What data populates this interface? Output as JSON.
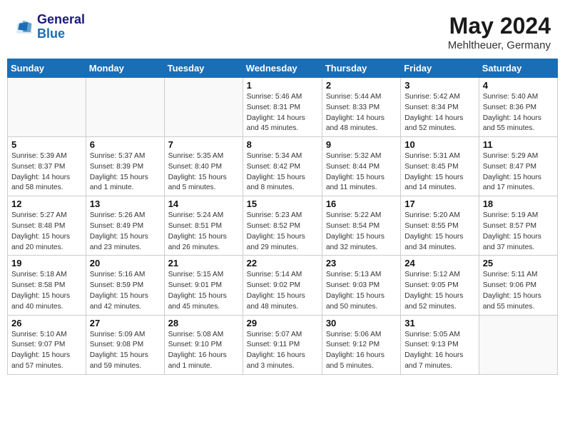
{
  "header": {
    "logo_line1": "General",
    "logo_line2": "Blue",
    "month_year": "May 2024",
    "location": "Mehltheuer, Germany"
  },
  "weekdays": [
    "Sunday",
    "Monday",
    "Tuesday",
    "Wednesday",
    "Thursday",
    "Friday",
    "Saturday"
  ],
  "weeks": [
    [
      {
        "day": "",
        "info": ""
      },
      {
        "day": "",
        "info": ""
      },
      {
        "day": "",
        "info": ""
      },
      {
        "day": "1",
        "info": "Sunrise: 5:46 AM\nSunset: 8:31 PM\nDaylight: 14 hours\nand 45 minutes."
      },
      {
        "day": "2",
        "info": "Sunrise: 5:44 AM\nSunset: 8:33 PM\nDaylight: 14 hours\nand 48 minutes."
      },
      {
        "day": "3",
        "info": "Sunrise: 5:42 AM\nSunset: 8:34 PM\nDaylight: 14 hours\nand 52 minutes."
      },
      {
        "day": "4",
        "info": "Sunrise: 5:40 AM\nSunset: 8:36 PM\nDaylight: 14 hours\nand 55 minutes."
      }
    ],
    [
      {
        "day": "5",
        "info": "Sunrise: 5:39 AM\nSunset: 8:37 PM\nDaylight: 14 hours\nand 58 minutes."
      },
      {
        "day": "6",
        "info": "Sunrise: 5:37 AM\nSunset: 8:39 PM\nDaylight: 15 hours\nand 1 minute."
      },
      {
        "day": "7",
        "info": "Sunrise: 5:35 AM\nSunset: 8:40 PM\nDaylight: 15 hours\nand 5 minutes."
      },
      {
        "day": "8",
        "info": "Sunrise: 5:34 AM\nSunset: 8:42 PM\nDaylight: 15 hours\nand 8 minutes."
      },
      {
        "day": "9",
        "info": "Sunrise: 5:32 AM\nSunset: 8:44 PM\nDaylight: 15 hours\nand 11 minutes."
      },
      {
        "day": "10",
        "info": "Sunrise: 5:31 AM\nSunset: 8:45 PM\nDaylight: 15 hours\nand 14 minutes."
      },
      {
        "day": "11",
        "info": "Sunrise: 5:29 AM\nSunset: 8:47 PM\nDaylight: 15 hours\nand 17 minutes."
      }
    ],
    [
      {
        "day": "12",
        "info": "Sunrise: 5:27 AM\nSunset: 8:48 PM\nDaylight: 15 hours\nand 20 minutes."
      },
      {
        "day": "13",
        "info": "Sunrise: 5:26 AM\nSunset: 8:49 PM\nDaylight: 15 hours\nand 23 minutes."
      },
      {
        "day": "14",
        "info": "Sunrise: 5:24 AM\nSunset: 8:51 PM\nDaylight: 15 hours\nand 26 minutes."
      },
      {
        "day": "15",
        "info": "Sunrise: 5:23 AM\nSunset: 8:52 PM\nDaylight: 15 hours\nand 29 minutes."
      },
      {
        "day": "16",
        "info": "Sunrise: 5:22 AM\nSunset: 8:54 PM\nDaylight: 15 hours\nand 32 minutes."
      },
      {
        "day": "17",
        "info": "Sunrise: 5:20 AM\nSunset: 8:55 PM\nDaylight: 15 hours\nand 34 minutes."
      },
      {
        "day": "18",
        "info": "Sunrise: 5:19 AM\nSunset: 8:57 PM\nDaylight: 15 hours\nand 37 minutes."
      }
    ],
    [
      {
        "day": "19",
        "info": "Sunrise: 5:18 AM\nSunset: 8:58 PM\nDaylight: 15 hours\nand 40 minutes."
      },
      {
        "day": "20",
        "info": "Sunrise: 5:16 AM\nSunset: 8:59 PM\nDaylight: 15 hours\nand 42 minutes."
      },
      {
        "day": "21",
        "info": "Sunrise: 5:15 AM\nSunset: 9:01 PM\nDaylight: 15 hours\nand 45 minutes."
      },
      {
        "day": "22",
        "info": "Sunrise: 5:14 AM\nSunset: 9:02 PM\nDaylight: 15 hours\nand 48 minutes."
      },
      {
        "day": "23",
        "info": "Sunrise: 5:13 AM\nSunset: 9:03 PM\nDaylight: 15 hours\nand 50 minutes."
      },
      {
        "day": "24",
        "info": "Sunrise: 5:12 AM\nSunset: 9:05 PM\nDaylight: 15 hours\nand 52 minutes."
      },
      {
        "day": "25",
        "info": "Sunrise: 5:11 AM\nSunset: 9:06 PM\nDaylight: 15 hours\nand 55 minutes."
      }
    ],
    [
      {
        "day": "26",
        "info": "Sunrise: 5:10 AM\nSunset: 9:07 PM\nDaylight: 15 hours\nand 57 minutes."
      },
      {
        "day": "27",
        "info": "Sunrise: 5:09 AM\nSunset: 9:08 PM\nDaylight: 15 hours\nand 59 minutes."
      },
      {
        "day": "28",
        "info": "Sunrise: 5:08 AM\nSunset: 9:10 PM\nDaylight: 16 hours\nand 1 minute."
      },
      {
        "day": "29",
        "info": "Sunrise: 5:07 AM\nSunset: 9:11 PM\nDaylight: 16 hours\nand 3 minutes."
      },
      {
        "day": "30",
        "info": "Sunrise: 5:06 AM\nSunset: 9:12 PM\nDaylight: 16 hours\nand 5 minutes."
      },
      {
        "day": "31",
        "info": "Sunrise: 5:05 AM\nSunset: 9:13 PM\nDaylight: 16 hours\nand 7 minutes."
      },
      {
        "day": "",
        "info": ""
      }
    ]
  ]
}
